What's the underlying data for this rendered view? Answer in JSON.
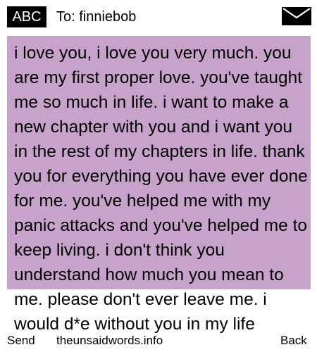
{
  "header": {
    "input_mode": "ABC",
    "recipient": "To: finniebob",
    "envelope_icon": "envelope-icon"
  },
  "message": {
    "text": "i love you, i love you very much. you are my first proper love. you've taught me so much in life. i want to make a new chapter with you and i want you in the rest of my chapters in life. thank you for everything you have ever done for me. you've helped me with my panic attacks and you've helped me to keep living. i don't think you understand how much you mean to me. please don't ever leave me. i would d*e without you in my life",
    "highlight_color": "#c7a3cb"
  },
  "footer": {
    "send_label": "Send",
    "site_label": "theunsaidwords.info",
    "back_label": "Back"
  }
}
